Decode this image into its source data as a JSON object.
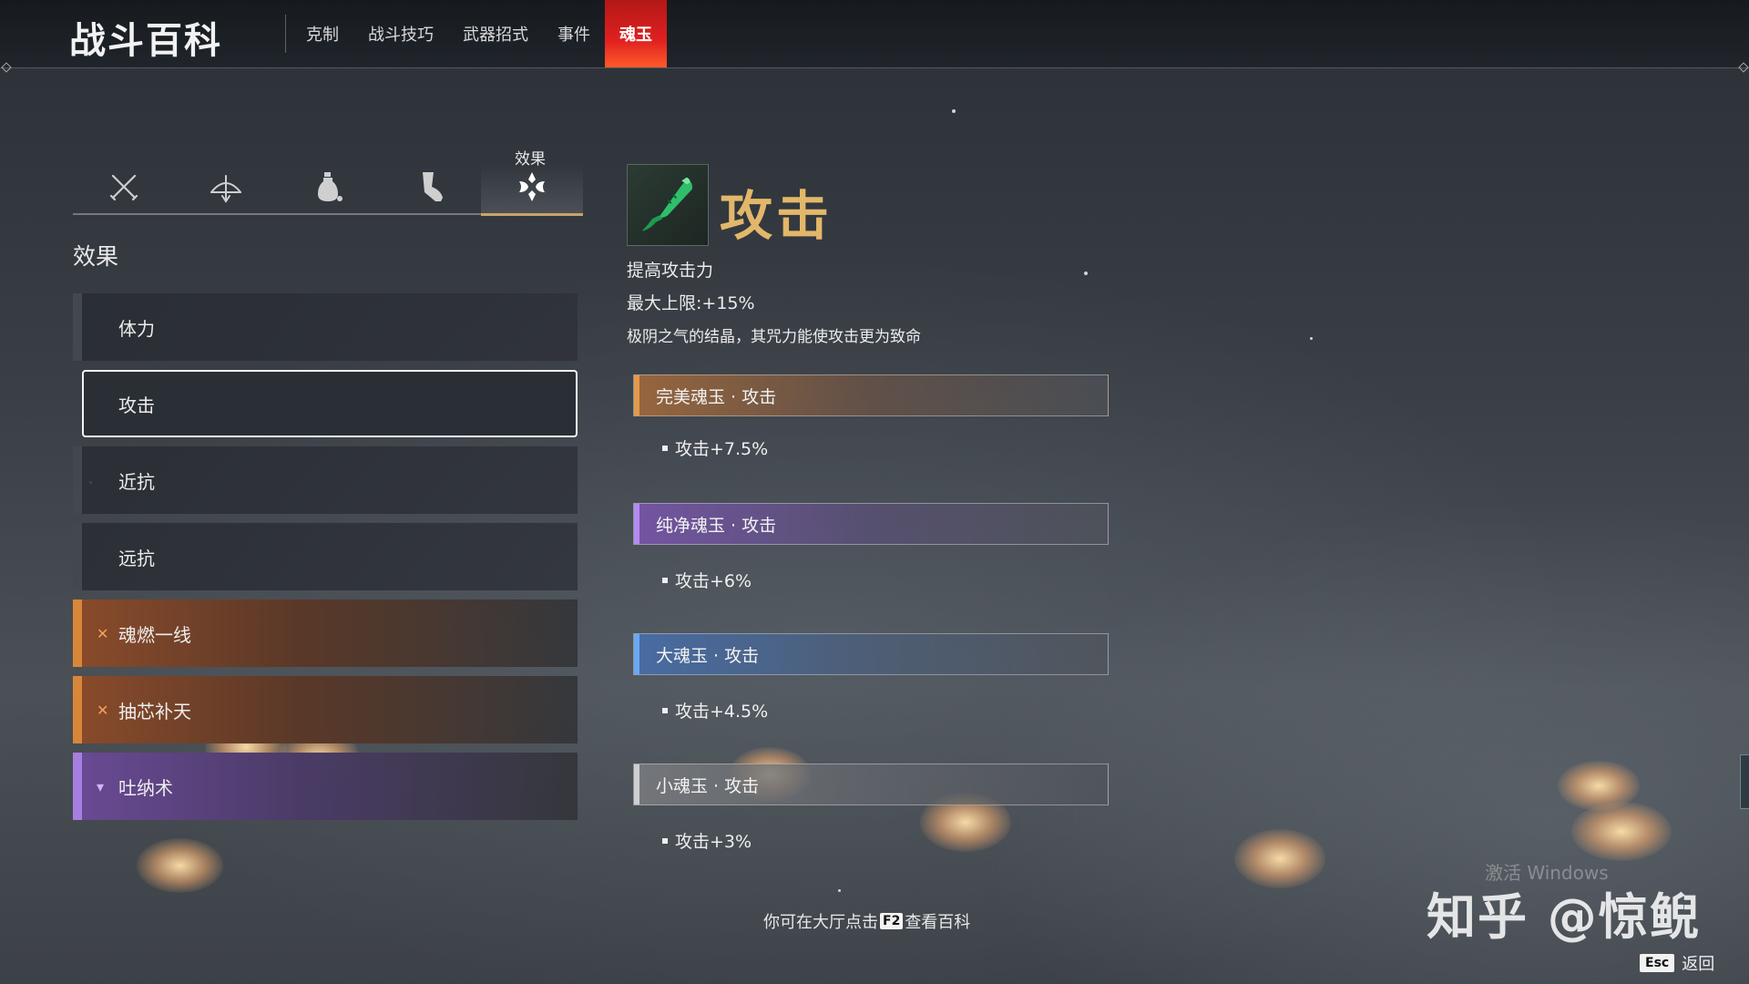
{
  "header": {
    "title": "战斗百科",
    "tabs": [
      {
        "label": "克制",
        "active": false
      },
      {
        "label": "战斗技巧",
        "active": false
      },
      {
        "label": "武器招式",
        "active": false
      },
      {
        "label": "事件",
        "active": false
      },
      {
        "label": "魂玉",
        "active": true
      }
    ]
  },
  "category_tabs": {
    "active_label": "效果",
    "items": [
      {
        "icon": "crossed-swords-icon"
      },
      {
        "icon": "bow-icon"
      },
      {
        "icon": "gourd-bottle-icon"
      },
      {
        "icon": "boot-icon"
      },
      {
        "icon": "soul-jade-effect-icon",
        "active": true
      }
    ]
  },
  "section": {
    "title": "效果"
  },
  "list": [
    {
      "label": "体力",
      "style": "normal"
    },
    {
      "label": "攻击",
      "style": "selected"
    },
    {
      "label": "近抗",
      "style": "normal"
    },
    {
      "label": "远抗",
      "style": "normal"
    },
    {
      "label": "魂燃一线",
      "style": "orange",
      "mark": "✕"
    },
    {
      "label": "抽芯补天",
      "style": "orange",
      "mark": "✕"
    },
    {
      "label": "吐纳术",
      "style": "purple",
      "mark": "▾"
    }
  ],
  "detail": {
    "title": "攻击",
    "icon": "jade-blade-icon",
    "desc1": "提高攻击力",
    "desc2": "最大上限:+15%",
    "desc3": "极阴之气的结晶，其咒力能使攻击更为致命",
    "tiers": [
      {
        "name": "完美魂玉 · 攻击",
        "bonus": "攻击+7.5%",
        "color": "#e39a4a"
      },
      {
        "name": "纯净魂玉 · 攻击",
        "bonus": "攻击+6%",
        "color": "#b58af2"
      },
      {
        "name": "大魂玉 · 攻击",
        "bonus": "攻击+4.5%",
        "color": "#6aa8f2"
      },
      {
        "name": "小魂玉 · 攻击",
        "bonus": "攻击+3%",
        "color": "#cfcfcf"
      }
    ]
  },
  "footer": {
    "hint_before": "你可在大厅点击",
    "hint_key": "F2",
    "hint_after": "查看百科",
    "back_key": "Esc",
    "back_label": "返回"
  },
  "watermarks": {
    "windows": "激活 Windows",
    "zhihu": "知乎 @惊鲵"
  }
}
